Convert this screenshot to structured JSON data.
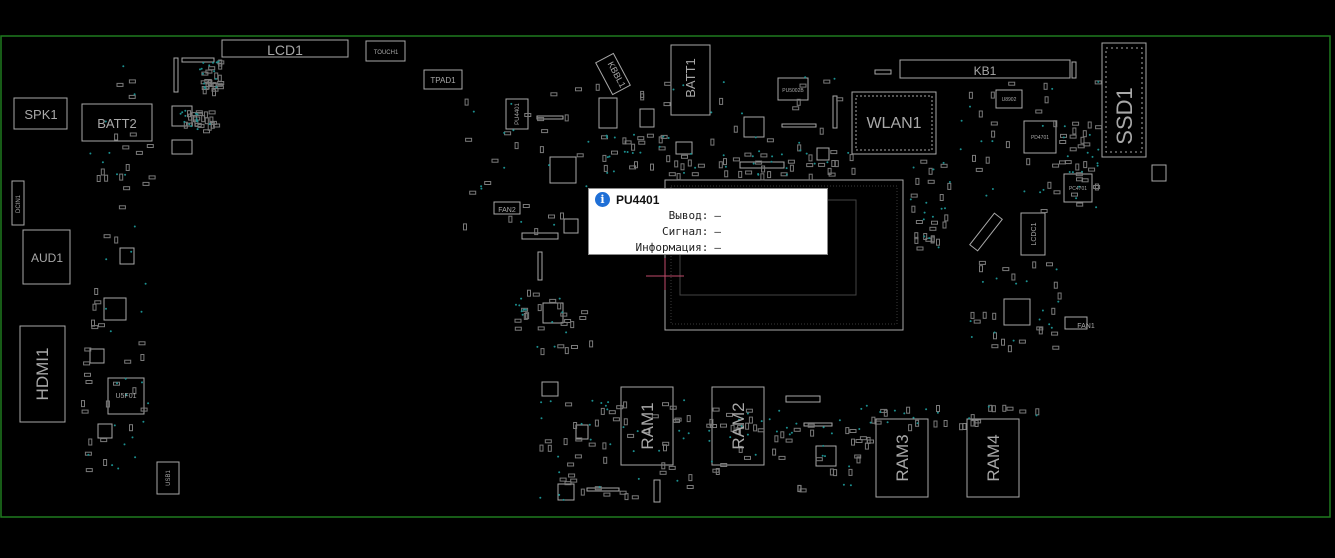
{
  "colors": {
    "outline": "#1f7a1f",
    "silk": "#a8a8a8",
    "via": "#1b8f8f",
    "bg": "#000000"
  },
  "components": {
    "lcd1": "LCD1",
    "touch1": "TOUCH1",
    "tpad1": "TPAD1",
    "kbbl1": "KBBL1",
    "batt1": "BATT1",
    "kb1": "KB1",
    "ssd1": "SSD1",
    "spk1": "SPK1",
    "batt2": "BATT2",
    "aud1": "AUD1",
    "hdmi1": "HDMI1",
    "wlan1": "WLAN1",
    "ram1": "RAM1",
    "ram2": "RAM2",
    "ram3": "RAM3",
    "ram4": "RAM4",
    "fan1": "FAN1",
    "fan2": "FAN2",
    "lcdc1": "LCDC1",
    "u5f01": "U5F01",
    "pu5002b": "PU5002B",
    "pu4x01": "PU4401",
    "pd4701": "PD4701",
    "pc4701": "PC4701",
    "u8902": "U8902",
    "dcin": "DCIN1",
    "usb": "USB1"
  },
  "tooltip": {
    "title": "PU4401",
    "rows": [
      {
        "label": "Вывод:",
        "value": "—"
      },
      {
        "label": "Сигнал:",
        "value": "—"
      },
      {
        "label": "Информация:",
        "value": "—"
      }
    ]
  }
}
